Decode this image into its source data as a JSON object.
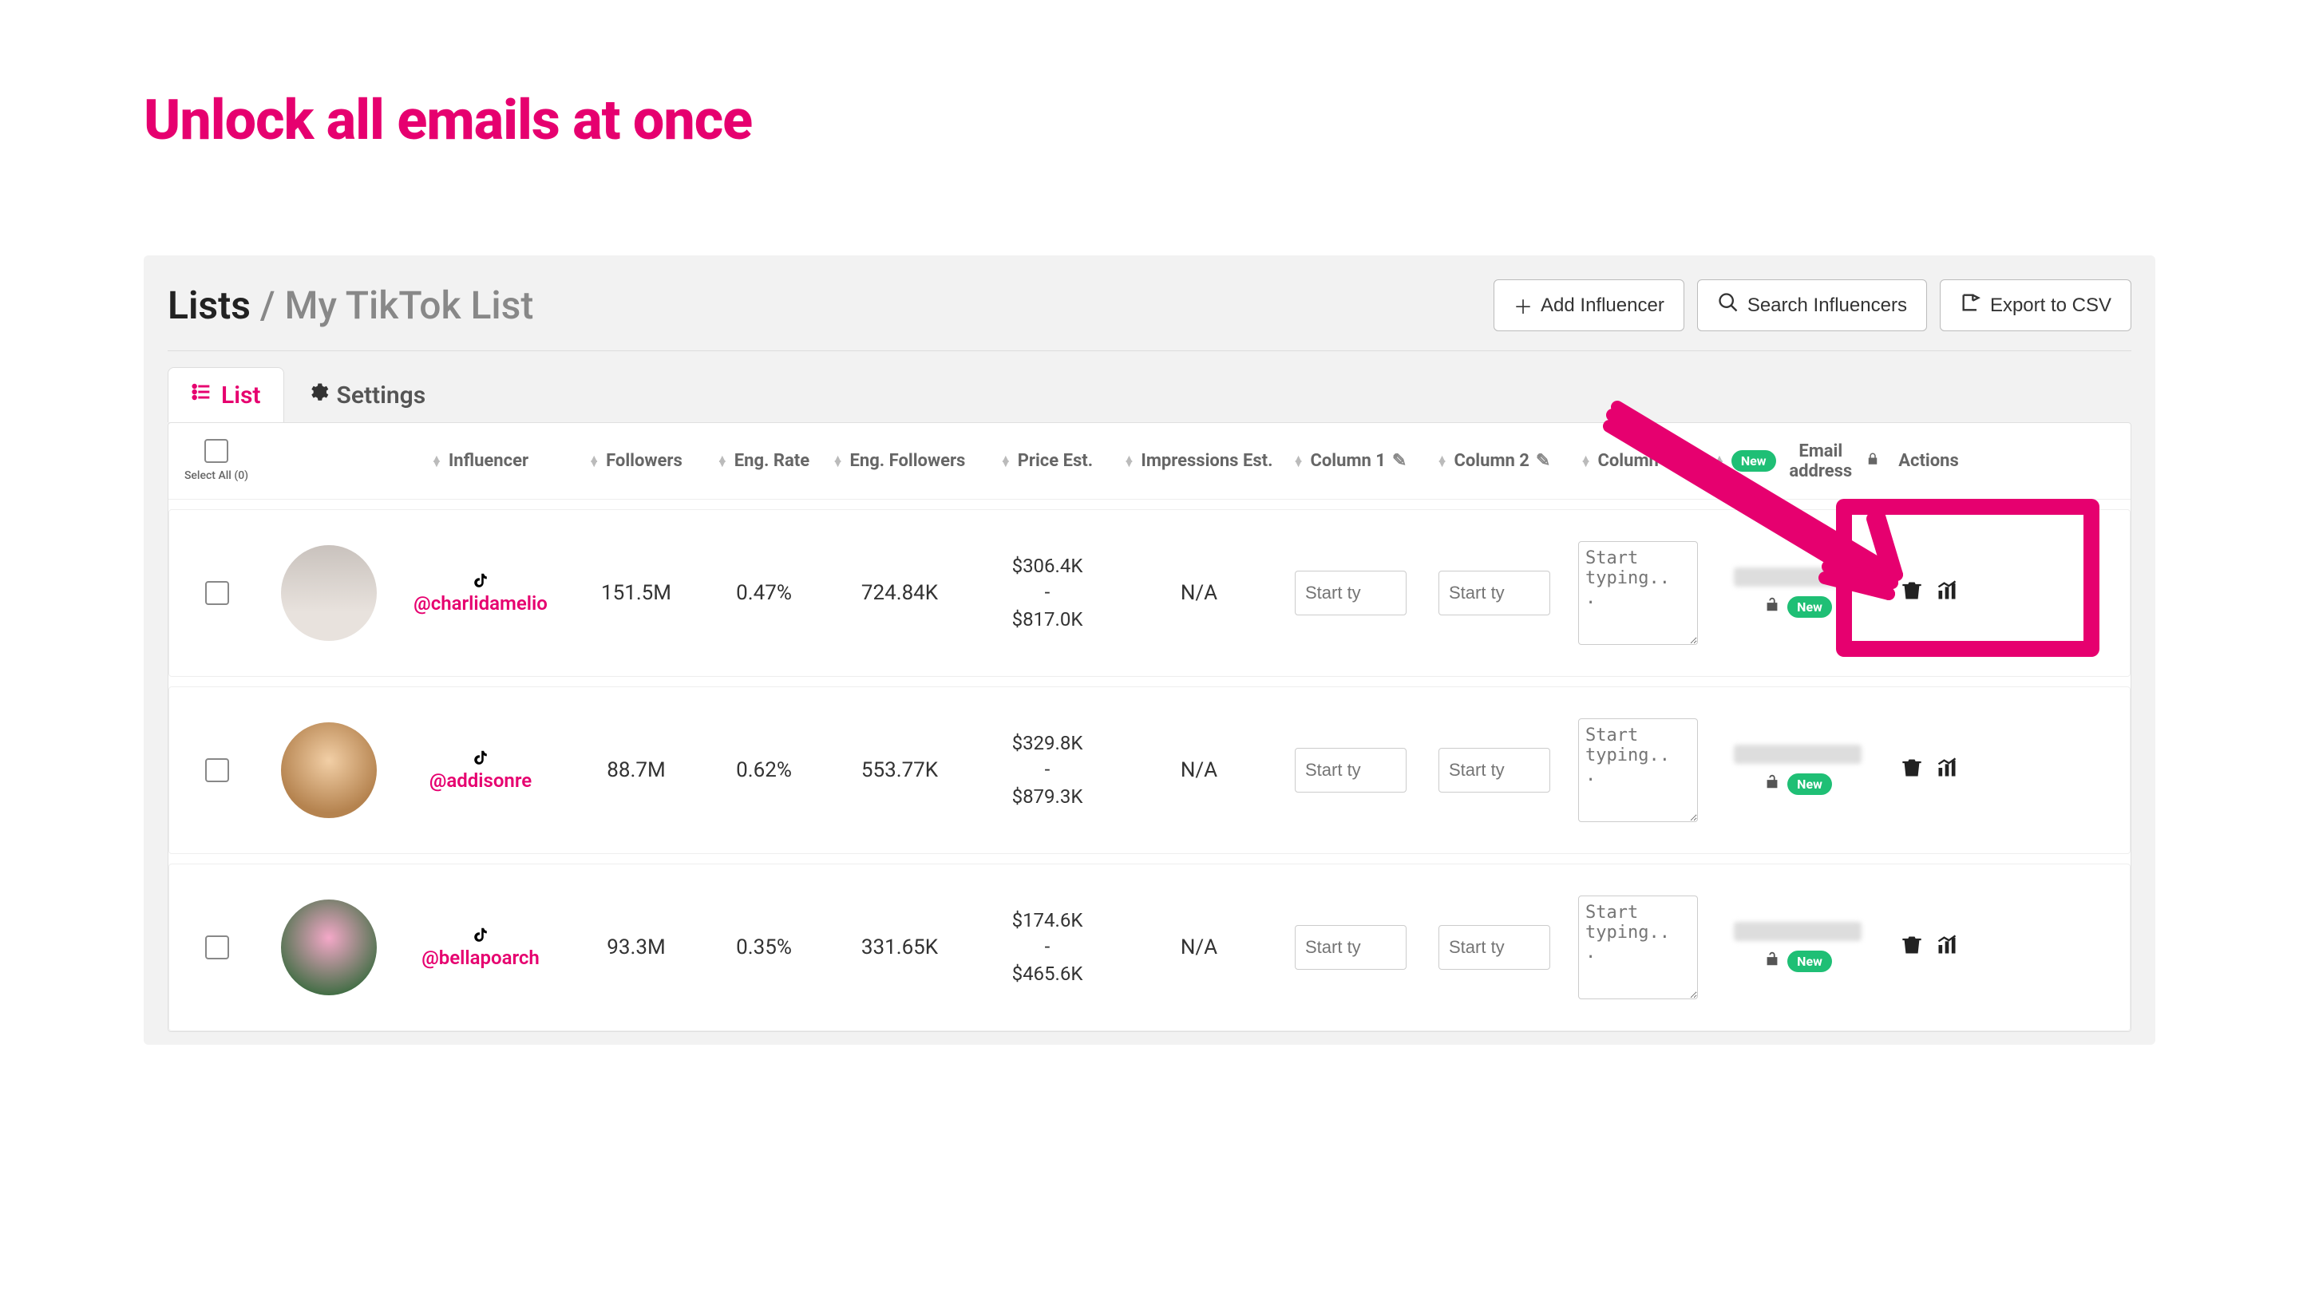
{
  "hero": {
    "title": "Unlock all emails at once"
  },
  "breadcrumb": {
    "root": "Lists",
    "sep": " / ",
    "current": "My TikTok List"
  },
  "buttons": {
    "add": "Add Influencer",
    "search": "Search Influencers",
    "export": "Export to CSV"
  },
  "tabs": {
    "list": "List",
    "settings": "Settings"
  },
  "columns": {
    "select_all": "Select All (0)",
    "influencer": "Influencer",
    "followers": "Followers",
    "eng_rate": "Eng. Rate",
    "eng_followers": "Eng. Followers",
    "price": "Price Est.",
    "impressions": "Impressions Est.",
    "col1": "Column 1",
    "col2": "Column 2",
    "col3": "Column 3",
    "email": "Email address",
    "email_new_badge": "New",
    "actions": "Actions"
  },
  "placeholders": {
    "short": "Start ty",
    "long": "Start typing.. ."
  },
  "rows": [
    {
      "handle": "@charlidamelio",
      "followers": "151.5M",
      "eng_rate": "0.47%",
      "eng_followers": "724.84K",
      "price_low": "$306.4K",
      "price_high": "$817.0K",
      "impressions": "N/A",
      "email_new_badge": "New",
      "avatar_bg": "linear-gradient(180deg,#c9c2bd 0%, #e8e2dd 70%)"
    },
    {
      "handle": "@addisonre",
      "followers": "88.7M",
      "eng_rate": "0.62%",
      "eng_followers": "553.77K",
      "price_low": "$329.8K",
      "price_high": "$879.3K",
      "impressions": "N/A",
      "email_new_badge": "New",
      "avatar_bg": "radial-gradient(circle at 50% 40%, #f2cfa6 0%, #b5834f 70%)"
    },
    {
      "handle": "@bellapoarch",
      "followers": "93.3M",
      "eng_rate": "0.35%",
      "eng_followers": "331.65K",
      "price_low": "$174.6K",
      "price_high": "$465.6K",
      "impressions": "N/A",
      "email_new_badge": "New",
      "avatar_bg": "radial-gradient(circle at 50% 40%, #f4a8c8 0%, #3a6b3f 80%)"
    }
  ]
}
